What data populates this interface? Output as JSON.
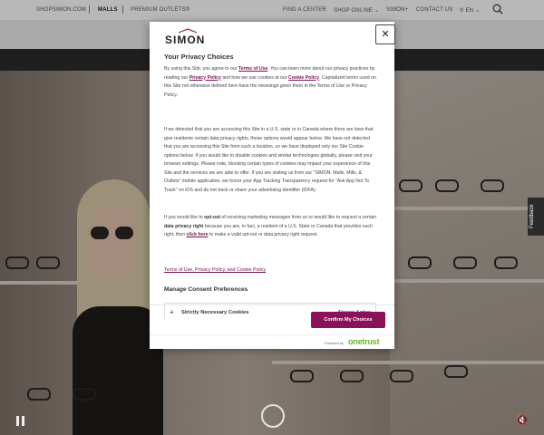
{
  "topnav": {
    "shopsimon": "SHOPSIMON.COM",
    "malls": "MALLS",
    "premium_outlets": "PREMIUM OUTLETS®",
    "find_center": "FIND A CENTER",
    "shop_online": "SHOP ONLINE",
    "simon_plus": "SIMON+",
    "contact": "CONTACT US",
    "language": "EN"
  },
  "feedback": "Feedback",
  "modal": {
    "logo": "SIMON",
    "close": "✕",
    "title": "Your Privacy Choices",
    "p1_a": "By using this Site, you agree to our ",
    "p1_terms": "Terms of Use",
    "p1_b": ". You can learn more about our privacy practices by reading our ",
    "p1_privacy": "Privacy Policy",
    "p1_c": " and how we use cookies at our ",
    "p1_cookie": "Cookie Policy",
    "p1_d": ". Capitalized terms used on this Site not otherwise defined here have the meanings given them in the Terms of Use or Privacy Policy.",
    "p2": "If we detected that you are accessing this Site in a U.S. state or in Canada where there are laws that give residents certain data privacy rights, those options would appear below. We have not detected that you are accessing this Site from such a location, so we have displayed only our Site Cookie options below. If you would like to disable cookies and similar technologies globally, please visit your browser settings. Please note, blocking certain types of cookies may impact your experience of this Site and the services we are able to offer. If you are visiting us from our \"SIMON: Malls, Mills, & Outlets\" mobile application, we honor your App Tracking Transparency request for \"Ask App Not To Track\" on iOS and do not track or share your advertising identifier (IDFA).",
    "p3_a": "If you would like to ",
    "p3_optout": "opt-out",
    "p3_b": " of receiving marketing messages from us or would like to request a certain ",
    "p3_right": "data privacy right",
    "p3_c": " because you are, in fact, a resident of a U.S. State or Canada that provides such right, then ",
    "p3_click": "click here",
    "p3_d": " to make a valid opt-out or data privacy right request.",
    "links": "Terms of Use, Privacy Policy, and Cookie Policy",
    "manage": "Manage Consent Preferences",
    "consent_plus": "+",
    "consent_label": "Strictly Necessary Cookies",
    "consent_status": "Always Active",
    "confirm": "Confirm My Choices",
    "powered": "Powered by",
    "onetrust": "onetrust"
  },
  "colors": {
    "accent": "#8b1258",
    "link": "#7a1052",
    "active": "#2a5ba8",
    "onetrust": "#68b631"
  }
}
